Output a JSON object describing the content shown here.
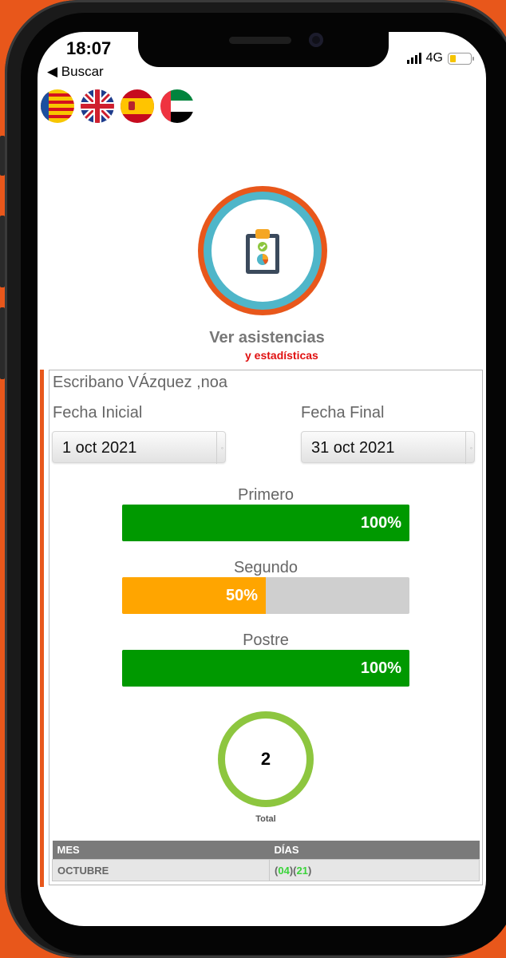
{
  "status_bar": {
    "time": "18:07",
    "back_label": "◀ Buscar",
    "network": "4G"
  },
  "languages": [
    {
      "code": "ca-valencia",
      "icon": "valencian-flag-icon"
    },
    {
      "code": "en",
      "icon": "uk-flag-icon"
    },
    {
      "code": "es",
      "icon": "spain-flag-icon"
    },
    {
      "code": "ar",
      "icon": "uae-flag-icon"
    }
  ],
  "header": {
    "icon": "clipboard-check-icon",
    "title": "Ver asistencias",
    "subtitle": "y estadísticas"
  },
  "student_name": "Escribano VÁzquez ,noa",
  "date_range": {
    "start_label": "Fecha Inicial",
    "start_value": "1 oct 2021",
    "end_label": "Fecha Final",
    "end_value": "31 oct 2021"
  },
  "progress": [
    {
      "label": "Primero",
      "percent": 100,
      "value_text": "100%",
      "color": "#009900"
    },
    {
      "label": "Segundo",
      "percent": 50,
      "value_text": "50%",
      "color": "#ffa500"
    },
    {
      "label": "Postre",
      "percent": 100,
      "value_text": "100%",
      "color": "#009900"
    }
  ],
  "total": {
    "value": "2",
    "label": "Total",
    "ring_color": "#8dc63f"
  },
  "table": {
    "headers": [
      "MES",
      "DÍAS"
    ],
    "rows": [
      {
        "month": "OCTUBRE",
        "days": [
          "04",
          "21"
        ]
      }
    ]
  },
  "colors": {
    "accent": "#e8571b",
    "teal": "#4fb6c9",
    "alert": "#e01010"
  }
}
